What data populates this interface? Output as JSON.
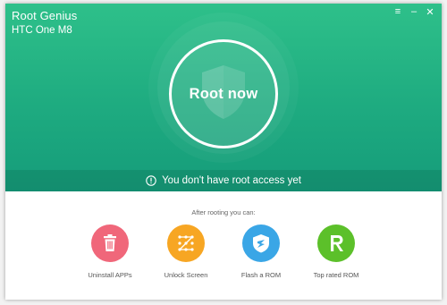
{
  "window": {
    "app_title": "Root Genius",
    "device_name": "HTC One M8",
    "controls": {
      "menu": "≡",
      "minimize": "–",
      "close": "✕"
    }
  },
  "hero": {
    "root_button_label": "Root now",
    "status_text": "You don't have root access yet",
    "colors": {
      "gradient_top": "#2ec08a",
      "gradient_bottom": "#159c7a"
    }
  },
  "after_rooting": {
    "label": "After rooting you can:",
    "features": [
      {
        "label": "Uninstall APPs",
        "icon": "trash-icon",
        "color": "#f0677a"
      },
      {
        "label": "Unlock Screen",
        "icon": "pattern-unlock-icon",
        "color": "#f7a623"
      },
      {
        "label": "Flash a ROM",
        "icon": "shield-flash-icon",
        "color": "#3aa6e6"
      },
      {
        "label": "Top rated ROM",
        "icon": "r-logo-icon",
        "color": "#5cc02a"
      }
    ]
  }
}
